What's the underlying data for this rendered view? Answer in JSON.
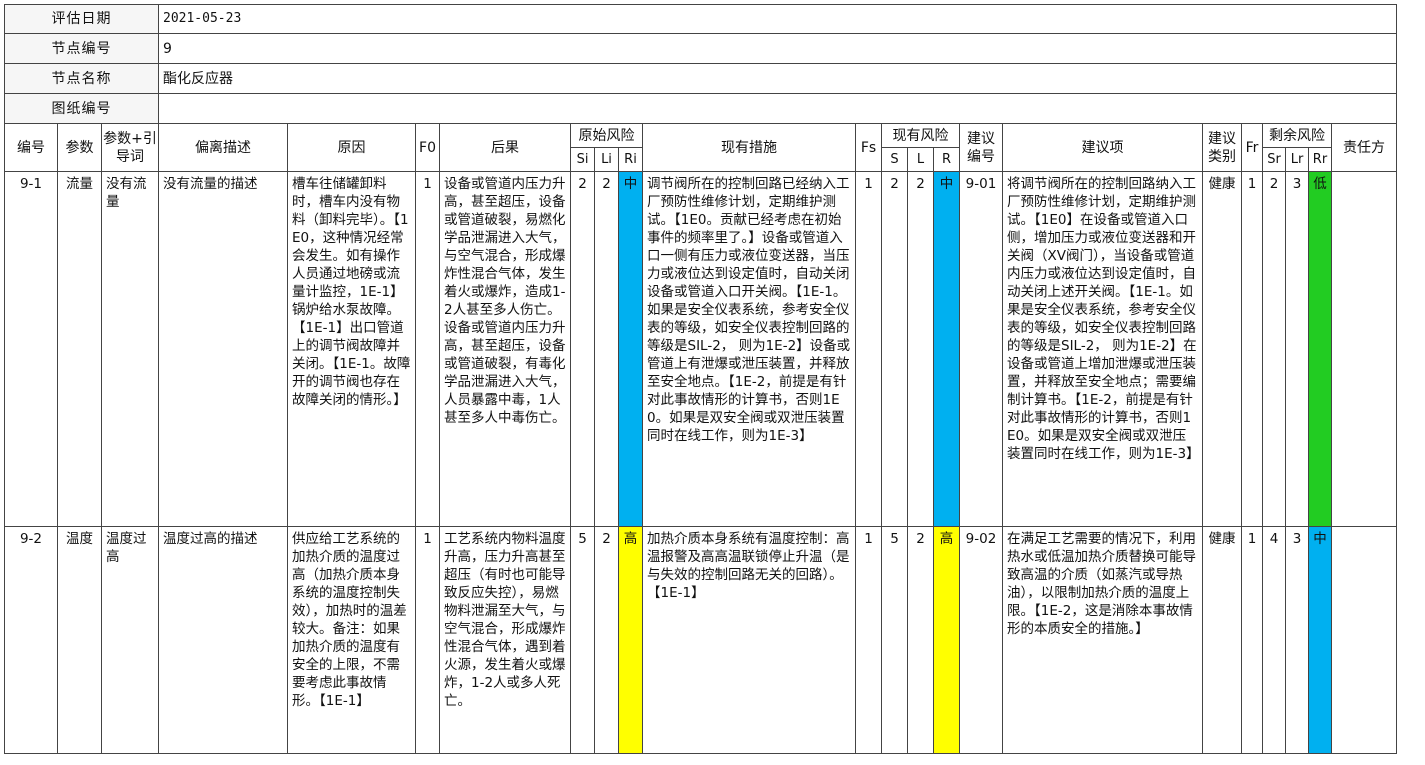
{
  "meta": [
    {
      "label": "评估日期",
      "value": "2021-05-23"
    },
    {
      "label": "节点编号",
      "value": "9"
    },
    {
      "label": "节点名称",
      "value": "酯化反应器"
    },
    {
      "label": "图纸编号",
      "value": ""
    }
  ],
  "headers": {
    "id": "编号",
    "param": "参数",
    "guide": "参数+引导词",
    "deviation": "偏离描述",
    "cause": "原因",
    "f0": "F0",
    "consequence": "后果",
    "orig_risk": "原始风险",
    "si": "Si",
    "li": "Li",
    "ri": "Ri",
    "measures": "现有措施",
    "fs": "Fs",
    "cur_risk": "现有风险",
    "s": "S",
    "l": "L",
    "r": "R",
    "rec_id": "建议编号",
    "rec": "建议项",
    "rec_type": "建议类别",
    "fr": "Fr",
    "resid_risk": "剩余风险",
    "sr": "Sr",
    "lr": "Lr",
    "rr": "Rr",
    "owner": "责任方"
  },
  "rows": [
    {
      "id": "9-1",
      "param": "流量",
      "guide": "没有流量",
      "deviation": "没有流量的描述",
      "cause": "槽车往储罐卸料时，槽车内没有物料（卸料完毕）。【1E0，这种情况经常会发生。如有操作人员通过地磅或流量计监控，1E-1】锅炉给水泵故障。【1E-1】出口管道上的调节阀故障并关闭。【1E-1。故障开的调节阀也存在故障关闭的情形。】",
      "f0": "1",
      "consequence": "设备或管道内压力升高，甚至超压，设备或管道破裂，易燃化学品泄漏进入大气，与空气混合，形成爆炸性混合气体，发生着火或爆炸，造成1-2人甚至多人伤亡。设备或管道内压力升高，甚至超压，设备或管道破裂，有毒化学品泄漏进入大气，人员暴露中毒，1人甚至多人中毒伤亡。",
      "si": "2",
      "li": "2",
      "ri": "中",
      "ri_color": "#00b0f0",
      "measures": "调节阀所在的控制回路已经纳入工厂预防性维修计划，定期维护测试。【1E0。贡献已经考虑在初始事件的频率里了。】设备或管道入口一侧有压力或液位变送器，当压力或液位达到设定值时，自动关闭设备或管道入口开关阀。【1E-1。如果是安全仪表系统，参考安全仪表的等级，如安全仪表控制回路的等级是SIL-2， 则为1E-2】设备或管道上有泄爆或泄压装置，并释放至安全地点。【1E-2，前提是有针对此事故情形的计算书，否则1E0。如果是双安全阀或双泄压装置同时在线工作，则为1E-3】",
      "fs": "1",
      "s": "2",
      "l": "2",
      "r": "中",
      "r_color": "#00b0f0",
      "rec_id": "9-01",
      "rec": "将调节阀所在的控制回路纳入工厂预防性维修计划，定期维护测试。【1E0】在设备或管道入口侧，增加压力或液位变送器和开关阀（XV阀门），当设备或管道内压力或液位达到设定值时，自动关闭上述开关阀。【1E-1。如果是安全仪表系统，参考安全仪表的等级，如安全仪表控制回路的等级是SIL-2， 则为1E-2】在设备或管道上增加泄爆或泄压装置，并释放至安全地点；需要编制计算书。【1E-2，前提是有针对此事故情形的计算书，否则1E0。如果是双安全阀或双泄压装置同时在线工作，则为1E-3】",
      "rec_type": "健康",
      "fr": "1",
      "sr": "2",
      "lr": "3",
      "rr": "低",
      "rr_color": "#22cc22",
      "owner": ""
    },
    {
      "id": "9-2",
      "param": "温度",
      "guide": "温度过高",
      "deviation": "温度过高的描述",
      "cause": "供应给工艺系统的加热介质的温度过高（加热介质本身系统的温度控制失效），加热时的温差较大。备注：如果加热介质的温度有安全的上限，不需要考虑此事故情形。【1E-1】",
      "f0": "1",
      "consequence": "工艺系统内物料温度升高，压力升高甚至超压（有时也可能导致反应失控），易燃物料泄漏至大气，与空气混合，形成爆炸性混合气体，遇到着火源，发生着火或爆炸，1-2人或多人死亡。",
      "si": "5",
      "li": "2",
      "ri": "高",
      "ri_color": "#ffff00",
      "measures": "加热介质本身系统有温度控制：高温报警及高高温联锁停止升温（是与失效的控制回路无关的回路）。【1E-1】",
      "fs": "1",
      "s": "5",
      "l": "2",
      "r": "高",
      "r_color": "#ffff00",
      "rec_id": "9-02",
      "rec": "在满足工艺需要的情况下，利用热水或低温加热介质替换可能导致高温的介质（如蒸汽或导热油），以限制加热介质的温度上限。【1E-2，这是消除本事故情形的本质安全的措施。】",
      "rec_type": "健康",
      "fr": "1",
      "sr": "4",
      "lr": "3",
      "rr": "中",
      "rr_color": "#00b0f0",
      "owner": ""
    }
  ]
}
